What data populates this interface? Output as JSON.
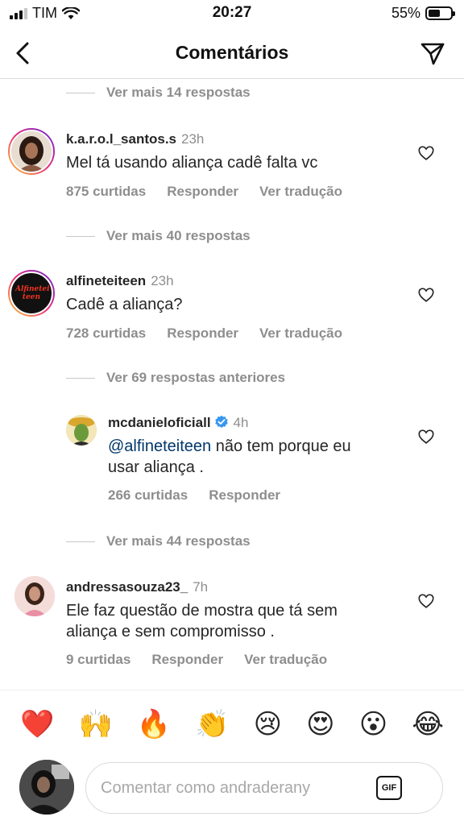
{
  "status_bar": {
    "carrier": "TIM",
    "time": "20:27",
    "battery": "55%",
    "battery_level": 0.55
  },
  "header": {
    "title": "Comentários",
    "back_icon": "chevron-left-icon",
    "send_icon": "paper-plane-icon"
  },
  "threads": {
    "more_1": "Ver mais 14 respostas",
    "more_2": "Ver mais 40 respostas",
    "more_3": "Ver 69 respostas anteriores",
    "more_4": "Ver mais 44 respostas"
  },
  "comments": [
    {
      "username": "k.a.r.o.l_santos.s",
      "time": "23h",
      "text": "Mel tá usando aliança cadê falta vc",
      "likes": "875 curtidas",
      "reply": "Responder",
      "translate": "Ver tradução"
    },
    {
      "username": "alfineteiteen",
      "time": "23h",
      "text": "Cadê a aliança?",
      "likes": "728 curtidas",
      "reply": "Responder",
      "translate": "Ver tradução",
      "avatar_text": "Alfinetei teen"
    },
    {
      "username": "mcdanieloficiall",
      "time": "4h",
      "mention": "@alfineteiteen",
      "text_line1": " não tem porque eu",
      "text_line2": "usar aliança .",
      "likes": "266 curtidas",
      "reply": "Responder"
    },
    {
      "username": "andressasouza23_",
      "time": "7h",
      "text_line1": "Ele faz questão de mostra que tá sem",
      "text_line2": "aliança e sem compromisso .",
      "likes": "9 curtidas",
      "reply": "Responder",
      "translate": "Ver tradução"
    }
  ],
  "emojis": [
    "❤️",
    "🙌",
    "🔥",
    "👏",
    "😢",
    "😍",
    "😮",
    "😂"
  ],
  "input": {
    "placeholder": "Comentar como andraderany",
    "gif_label": "GIF"
  },
  "colors": {
    "link": "#00376b",
    "muted": "#8e8e8e",
    "verified": "#3897f0"
  }
}
